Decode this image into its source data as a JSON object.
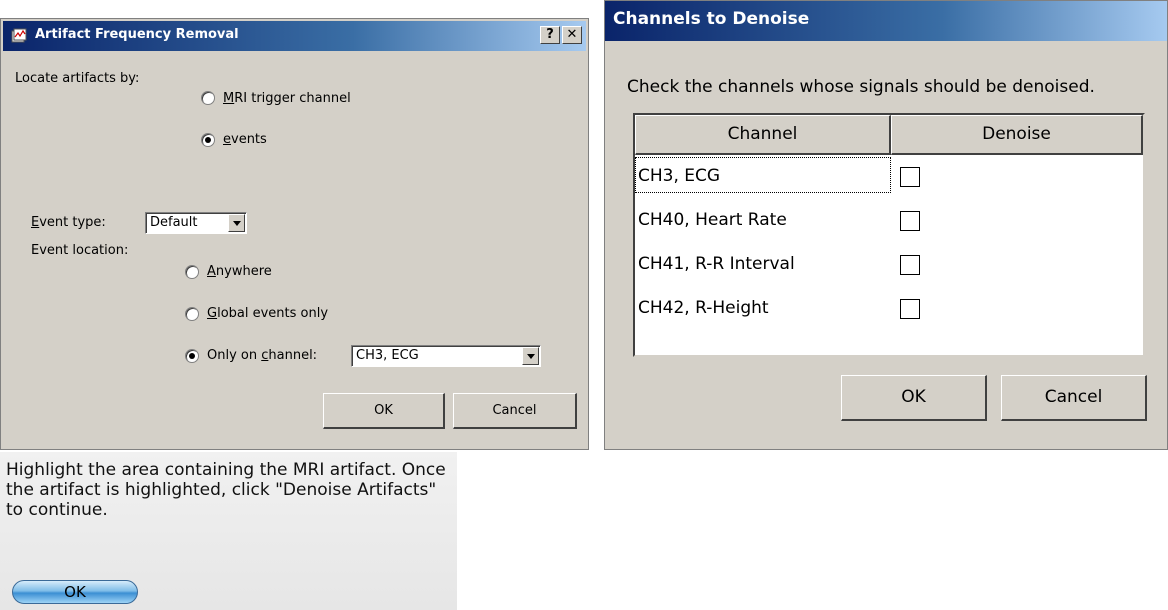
{
  "artifact_dialog": {
    "title": "Artifact Frequency Removal",
    "help_button": "?",
    "close_button": "✕",
    "locate_label": "Locate artifacts by:",
    "locate_options": [
      "MRI trigger channel",
      "events"
    ],
    "locate_selected": "events",
    "event_type_label": "Event type:",
    "event_type_value": "Default",
    "event_location_label": "Event location:",
    "location_options": [
      "Anywhere",
      "Global events only",
      "Only on channel:"
    ],
    "location_selected": "Only on channel:",
    "channel_value": "CH3, ECG",
    "ok_label": "OK",
    "cancel_label": "Cancel"
  },
  "channels_dialog": {
    "title": "Channels to Denoise",
    "instruction": "Check the channels whose signals should be denoised.",
    "columns": [
      "Channel",
      "Denoise"
    ],
    "rows": [
      {
        "channel": "CH3, ECG",
        "denoise": false
      },
      {
        "channel": "CH40, Heart Rate",
        "denoise": false
      },
      {
        "channel": "CH41, R-R Interval",
        "denoise": false
      },
      {
        "channel": "CH42, R-Height",
        "denoise": false
      }
    ],
    "ok_label": "OK",
    "cancel_label": "Cancel"
  },
  "message": {
    "text": "Highlight the area containing the MRI artifact.  Once the artifact is highlighted, click \"Denoise Artifacts\" to continue.",
    "ok_label": "OK"
  },
  "colors": {
    "title_bar": "#0a246a",
    "dialog_face": "#d4d0c8",
    "mac_button": "#5ea9e0"
  }
}
